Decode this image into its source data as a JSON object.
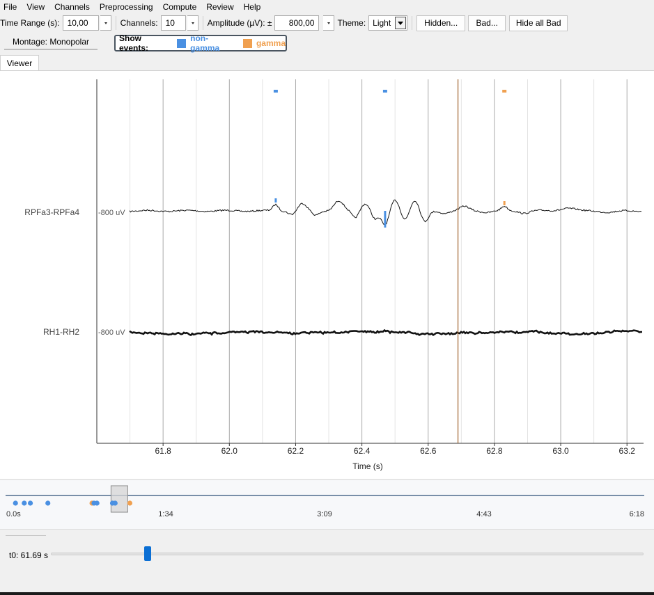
{
  "menu": [
    "File",
    "View",
    "Channels",
    "Preprocessing",
    "Compute",
    "Review",
    "Help"
  ],
  "toolbar": {
    "time_range_label": "Time Range (s):",
    "time_range_value": "10,00",
    "channels_label": "Channels:",
    "channels_value": "10",
    "amplitude_label": "Amplitude (µV): ±",
    "amplitude_value": "800,00",
    "theme_label": "Theme:",
    "theme_value": "Light",
    "hidden_button": "Hidden...",
    "bad_button": "Bad...",
    "hide_all_bad_button": "Hide all Bad"
  },
  "montage": "Montage: Monopolar",
  "events": {
    "label": "Show events:",
    "items": [
      {
        "name": "non-gamma",
        "color": "#4a90e2"
      },
      {
        "name": "gamma",
        "color": "#f0a050"
      }
    ]
  },
  "tabs": [
    "Viewer"
  ],
  "viewer": {
    "channels": [
      {
        "name": "RPFa3-RPFa4",
        "scale": "-800 uV"
      },
      {
        "name": "RH1-RH2",
        "scale": "-800 uV"
      }
    ],
    "x_ticks": [
      "61.8",
      "62.0",
      "62.2",
      "62.4",
      "62.6",
      "62.8",
      "63.0",
      "63.2"
    ],
    "x_label": "Time (s)",
    "time_window": [
      61.6,
      63.25
    ],
    "cursor_time": 62.69,
    "event_markers": [
      {
        "type": "non-gamma",
        "time": 62.14
      },
      {
        "type": "non-gamma",
        "time": 62.47
      },
      {
        "type": "gamma",
        "time": 62.83
      }
    ]
  },
  "overview": {
    "tick_labels": [
      "0.0s",
      "1:34",
      "3:09",
      "4:43",
      "6:18"
    ],
    "window_start_s": 61.69,
    "event_dots": [
      {
        "type": "non-gamma",
        "time": 2.2
      },
      {
        "type": "non-gamma",
        "time": 7.5
      },
      {
        "type": "non-gamma",
        "time": 11.2
      },
      {
        "type": "non-gamma",
        "time": 21.8
      },
      {
        "type": "gamma",
        "time": 48.5
      },
      {
        "type": "non-gamma",
        "time": 49.7
      },
      {
        "type": "non-gamma",
        "time": 51.5
      },
      {
        "type": "non-gamma",
        "time": 60.9
      },
      {
        "type": "non-gamma",
        "time": 62.5
      },
      {
        "type": "gamma",
        "time": 71.4
      }
    ]
  },
  "t0": {
    "label": "t0: 61.69 s",
    "value": 61.69,
    "max": 378
  },
  "colors": {
    "non_gamma": "#4a90e2",
    "gamma": "#f0a050",
    "cursor": "#a0612a",
    "slider": "#0b6fd4"
  }
}
